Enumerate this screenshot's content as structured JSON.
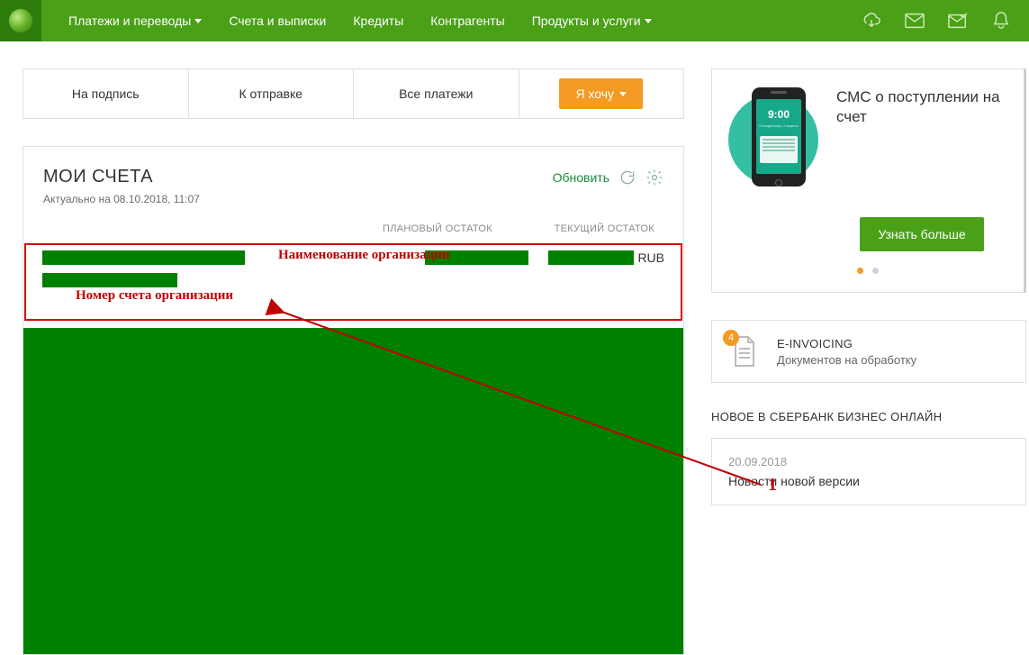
{
  "nav": {
    "items": [
      "Платежи и переводы",
      "Счета и выписки",
      "Кредиты",
      "Контрагенты",
      "Продукты и услуги"
    ],
    "dropdown_flags": [
      true,
      false,
      false,
      false,
      true
    ]
  },
  "tabs": {
    "items": [
      "На подпись",
      "К отправке",
      "Все платежи"
    ],
    "action_label": "Я хочу"
  },
  "accounts": {
    "title": "МОИ СЧЕТА",
    "subtitle": "Актуально на 08.10.2018, 11:07",
    "refresh_label": "Обновить",
    "col_plan": "ПЛАНОВЫЙ ОСТАТОК",
    "col_curr": "ТЕКУЩИЙ ОСТАТОК",
    "currency": "RUB"
  },
  "annotations": {
    "org_name": "Наименование организации",
    "acct_number": "Номер счета организации",
    "pointer_label": "1"
  },
  "promo": {
    "title": "СМС о поступлении на счет",
    "phone_time": "9:00",
    "button": "Узнать больше"
  },
  "einvoicing": {
    "badge": "4",
    "title": "E-INVOICING",
    "subtitle": "Документов на обработку"
  },
  "news": {
    "section_title": "НОВОЕ В СБЕРБАНК БИЗНЕС ОНЛАЙН",
    "date": "20.09.2018",
    "headline": "Новости новой версии"
  }
}
